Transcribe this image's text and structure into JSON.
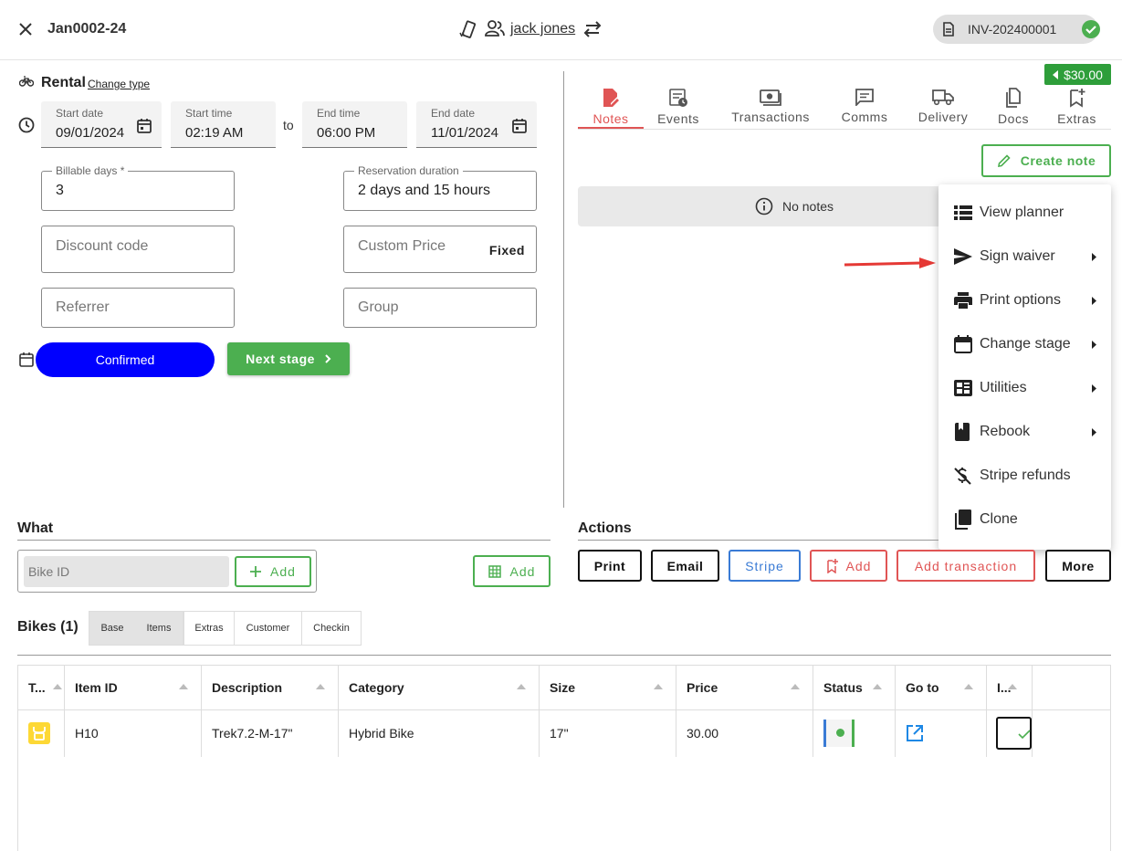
{
  "header": {
    "booking_id": "Jan0002-24",
    "customer_name": "jack jones",
    "invoice_number": "INV-202400001"
  },
  "rental": {
    "type_label": "Rental",
    "change_type_label": "Change type",
    "start_date": {
      "label": "Start date",
      "value": "09/01/2024"
    },
    "start_time": {
      "label": "Start time",
      "value": "02:19 AM"
    },
    "to_label": "to",
    "end_time": {
      "label": "End time",
      "value": "06:00 PM"
    },
    "end_date": {
      "label": "End date",
      "value": "11/01/2024"
    },
    "billable_days": {
      "label": "Billable days *",
      "value": "3"
    },
    "reservation_duration": {
      "label": "Reservation duration",
      "value": "2 days and 15 hours"
    },
    "discount_code_placeholder": "Discount code",
    "custom_price_placeholder": "Custom Price",
    "fixed_label": "Fixed",
    "referrer_placeholder": "Referrer",
    "group_placeholder": "Group",
    "stage_label": "Confirmed",
    "next_stage_label": "Next stage"
  },
  "right_panel": {
    "balance": "$30.00",
    "tabs": [
      {
        "label": "Notes",
        "icon": "note-edit-icon",
        "active": true
      },
      {
        "label": "Events",
        "icon": "events-icon"
      },
      {
        "label": "Transactions",
        "icon": "money-icon"
      },
      {
        "label": "Comms",
        "icon": "chat-icon"
      },
      {
        "label": "Delivery",
        "icon": "truck-icon"
      },
      {
        "label": "Docs",
        "icon": "docs-icon"
      },
      {
        "label": "Extras",
        "icon": "bookmark-add-icon"
      }
    ],
    "create_note_label": "Create note",
    "no_notes_label": "No notes"
  },
  "context_menu": {
    "items": [
      {
        "label": "View planner",
        "icon": "list-icon",
        "submenu": false
      },
      {
        "label": "Sign waiver",
        "icon": "send-icon",
        "submenu": true
      },
      {
        "label": "Print options",
        "icon": "printer-icon",
        "submenu": true
      },
      {
        "label": "Change stage",
        "icon": "calendar-icon",
        "submenu": true
      },
      {
        "label": "Utilities",
        "icon": "dashboard-icon",
        "submenu": true
      },
      {
        "label": "Rebook",
        "icon": "book-icon",
        "submenu": true
      },
      {
        "label": "Stripe refunds",
        "icon": "money-off-icon",
        "submenu": false
      },
      {
        "label": "Clone",
        "icon": "copy-icon",
        "submenu": false
      }
    ]
  },
  "what": {
    "title": "What",
    "bike_id_placeholder": "Bike ID",
    "add_label": "Add",
    "add_grid_label": "Add"
  },
  "actions": {
    "title": "Actions",
    "print_label": "Print",
    "email_label": "Email",
    "stripe_label": "Stripe",
    "add_label": "Add",
    "add_transaction_label": "Add transaction",
    "more_label": "More"
  },
  "bikes": {
    "title": "Bikes (1)",
    "views": [
      "Base",
      "Items",
      "Extras",
      "Customer",
      "Checkin"
    ],
    "columns": [
      "T...",
      "Item ID",
      "Description",
      "Category",
      "Size",
      "Price",
      "Status",
      "Go to",
      "I..."
    ],
    "rows": [
      {
        "item_id": "H10",
        "description": "Trek7.2-M-17\"",
        "category": "Hybrid Bike",
        "size": "17\"",
        "price": "30.00"
      }
    ]
  },
  "colors": {
    "green": "#4caf50",
    "blue": "#0000ff",
    "red": "#e05555",
    "accent_blue": "#3a7bd5"
  }
}
